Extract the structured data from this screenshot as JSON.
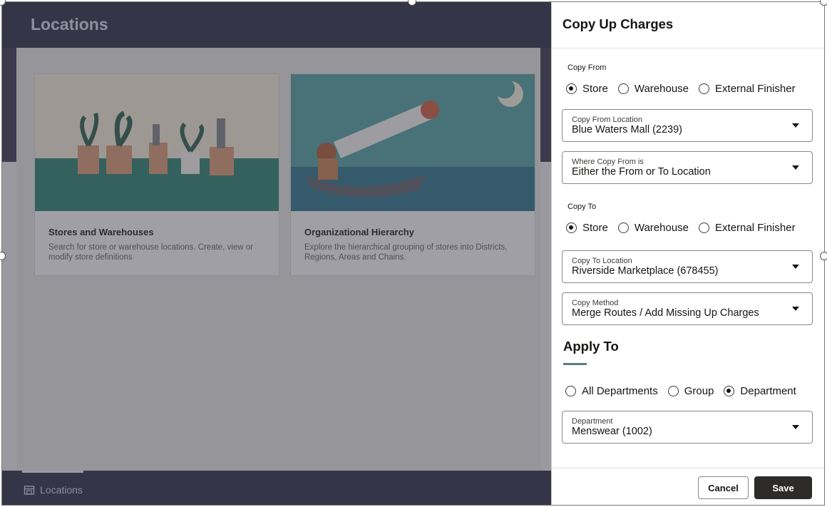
{
  "background": {
    "page_title": "Locations",
    "cards": [
      {
        "title": "Stores and Warehouses",
        "description": "Search for store or warehouse locations. Create, view or modify store definitions"
      },
      {
        "title": "Organizational Hierarchy",
        "description": "Explore the hierarchical grouping of stores into Districts, Regions, Areas and Chains."
      }
    ],
    "footer_link": "Locations"
  },
  "drawer": {
    "title": "Copy Up Charges",
    "copy_from": {
      "label": "Copy From",
      "options": [
        "Store",
        "Warehouse",
        "External Finisher"
      ],
      "selected": "Store",
      "location": {
        "label": "Copy From Location",
        "value": "Blue Waters Mall (2239)"
      },
      "where": {
        "label": "Where Copy From is",
        "value": "Either the From or To Location"
      }
    },
    "copy_to": {
      "label": "Copy To",
      "options": [
        "Store",
        "Warehouse",
        "External Finisher"
      ],
      "selected": "Store",
      "location": {
        "label": "Copy To Location",
        "value": "Riverside Marketplace (678455)"
      },
      "method": {
        "label": "Copy Method",
        "value": "Merge Routes / Add Missing Up Charges"
      }
    },
    "apply_to": {
      "title": "Apply To",
      "options": [
        "All Departments",
        "Group",
        "Department"
      ],
      "selected": "Department",
      "department": {
        "label": "Department",
        "value": "Menswear (1002)"
      }
    },
    "buttons": {
      "cancel": "Cancel",
      "save": "Save"
    }
  },
  "colors": {
    "primary_button": "#2e2c2a",
    "overlay": "#3f3e52",
    "accent_underline": "#5b7c84"
  }
}
